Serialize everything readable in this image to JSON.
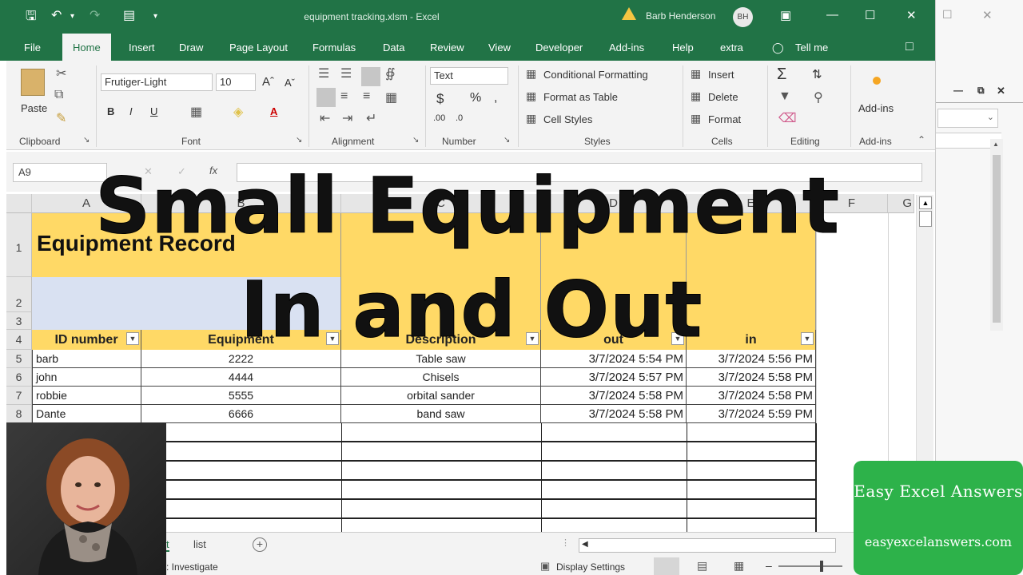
{
  "window": {
    "title": "equipment tracking.xlsm  -  Excel",
    "user": "Barb Henderson",
    "user_initials": "BH"
  },
  "tabs": [
    "File",
    "Home",
    "Insert",
    "Draw",
    "Page Layout",
    "Formulas",
    "Data",
    "Review",
    "View",
    "Developer",
    "Add-ins",
    "Help",
    "extra",
    "Tell me"
  ],
  "ribbon": {
    "clipboard": {
      "paste": "Paste",
      "label": "Clipboard"
    },
    "font": {
      "name": "Frutiger-Light",
      "size": "10",
      "label": "Font"
    },
    "alignment": {
      "label": "Alignment"
    },
    "number": {
      "format": "Text",
      "label": "Number"
    },
    "styles": {
      "conditional": "Conditional Formatting",
      "format_table": "Format as Table",
      "cell_styles": "Cell Styles",
      "label": "Styles"
    },
    "cells": {
      "insert": "Insert",
      "delete": "Delete",
      "format": "Format",
      "label": "Cells"
    },
    "editing": {
      "label": "Editing"
    },
    "addins": {
      "button": "Add-ins",
      "label": "Add-ins"
    }
  },
  "formula_bar": {
    "name_box": "A9",
    "cancel": "✕",
    "enter": "✓",
    "fx": "fx"
  },
  "columns": [
    "A",
    "B",
    "C",
    "D",
    "E",
    "F",
    "G"
  ],
  "rows": [
    "1",
    "2",
    "3",
    "4",
    "5",
    "6",
    "7",
    "8"
  ],
  "sheet": {
    "title": "Equipment Record",
    "headers": [
      "ID number",
      "Equipment",
      "Description",
      "out",
      "in"
    ],
    "records": [
      [
        "barb",
        "2222",
        "Table saw",
        "3/7/2024 5:54 PM",
        "3/7/2024 5:56 PM"
      ],
      [
        "john",
        "4444",
        "Chisels",
        "3/7/2024 5:57 PM",
        "3/7/2024 5:58 PM"
      ],
      [
        "robbie",
        "5555",
        "orbital sander",
        "3/7/2024 5:58 PM",
        "3/7/2024 5:58 PM"
      ],
      [
        "Dante",
        "6666",
        "band saw",
        "3/7/2024 5:58 PM",
        "3/7/2024 5:59 PM"
      ]
    ]
  },
  "sheet_tabs": [
    "t",
    "list"
  ],
  "status": {
    "left": ": Investigate",
    "display_settings": "Display Settings"
  },
  "overlay": {
    "line1": "Small Equipment",
    "line2": "In and Out"
  },
  "brand": {
    "name": "Easy Excel Answers",
    "url": "easyexcelanswers.com"
  }
}
